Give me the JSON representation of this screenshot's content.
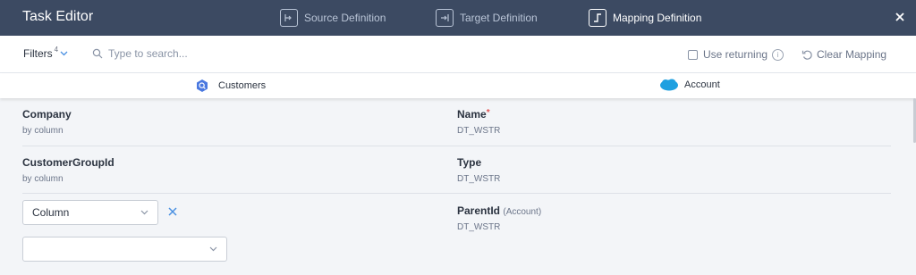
{
  "header": {
    "title": "Task Editor",
    "steps": [
      {
        "label": "Source Definition",
        "icon": "source-definition-icon",
        "active": false
      },
      {
        "label": "Target Definition",
        "icon": "target-definition-icon",
        "active": false
      },
      {
        "label": "Mapping Definition",
        "icon": "mapping-definition-icon",
        "active": true
      }
    ]
  },
  "toolbar": {
    "filters_label": "Filters",
    "filters_count": "4",
    "search_placeholder": "Type to search...",
    "use_returning_label": "Use returning",
    "clear_mapping_label": "Clear Mapping"
  },
  "source": {
    "name": "Customers",
    "icon": "bigquery-icon"
  },
  "target": {
    "name": "Account",
    "icon": "salesforce-icon"
  },
  "mappings": [
    {
      "source_field": "Company",
      "source_mode": "by column",
      "target_field": "Name",
      "target_required": "*",
      "target_type": "DT_WSTR"
    },
    {
      "source_field": "CustomerGroupId",
      "source_mode": "by column",
      "target_field": "Type",
      "target_type": "DT_WSTR"
    },
    {
      "source_select_value": "Column",
      "source_column_value": "",
      "target_field": "ParentId",
      "target_context": "(Account)",
      "target_type": "DT_WSTR"
    }
  ],
  "colors": {
    "header_bg": "#3c4a62",
    "accent": "#4a90e2",
    "required": "#e05454"
  }
}
